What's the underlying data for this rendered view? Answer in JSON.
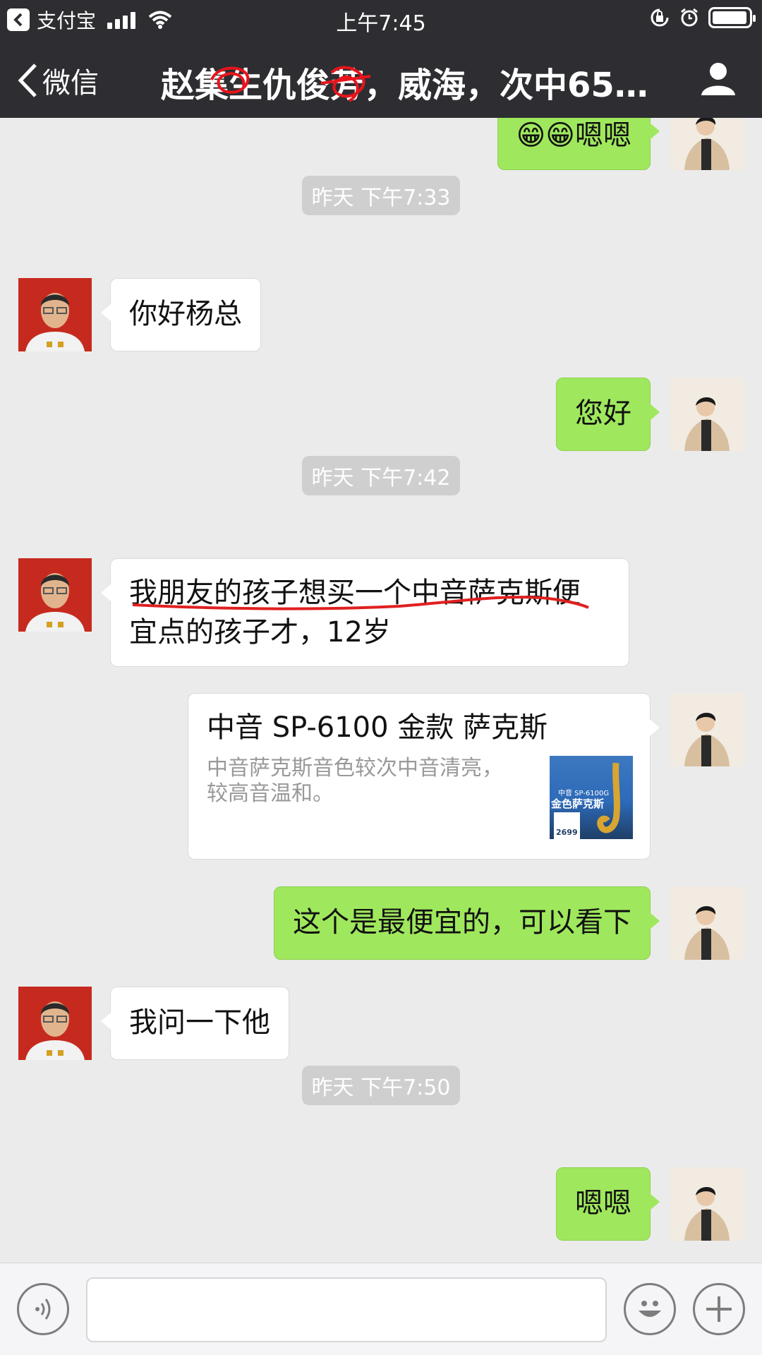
{
  "status_bar": {
    "back_app": "支付宝",
    "time": "上午7:45",
    "battery_level": 0.95
  },
  "nav": {
    "back_label": "微信",
    "title": "赵集生仇俊芳，威海，次中65…"
  },
  "messages": [
    {
      "type": "text",
      "side": "right",
      "text": "😁😁嗯嗯"
    },
    {
      "type": "time",
      "text": "昨天 下午7:33"
    },
    {
      "type": "text",
      "side": "left",
      "text": "你好杨总"
    },
    {
      "type": "text",
      "side": "right",
      "text": "您好"
    },
    {
      "type": "time",
      "text": "昨天 下午7:42"
    },
    {
      "type": "text",
      "side": "left",
      "line1": "我朋友的孩子想买一个中音萨克斯便",
      "line2": "宜点的孩子才，12岁"
    },
    {
      "type": "card",
      "side": "right",
      "title": "中音 SP-6100 金款 萨克斯",
      "description": "中音萨克斯音色较次中音清亮，较高音温和。",
      "thumb_small": "中音 SP-6100G",
      "thumb_big": "金色萨克斯",
      "thumb_price": "2699"
    },
    {
      "type": "text",
      "side": "right",
      "text": "这个是最便宜的，可以看下"
    },
    {
      "type": "text",
      "side": "left",
      "text": "我问一下他"
    },
    {
      "type": "time",
      "text": "昨天 下午7:50"
    },
    {
      "type": "text",
      "side": "right",
      "text": "嗯嗯"
    }
  ],
  "icons": {
    "voice": "voice-icon",
    "emoji": "emoji-icon",
    "plus": "plus-icon",
    "profile": "profile-icon",
    "back": "chevron-left-icon"
  },
  "colors": {
    "header": "#2e2e32",
    "chat_bg": "#ebebeb",
    "bubble_green": "#9fe85d",
    "underline": "#e02020"
  }
}
